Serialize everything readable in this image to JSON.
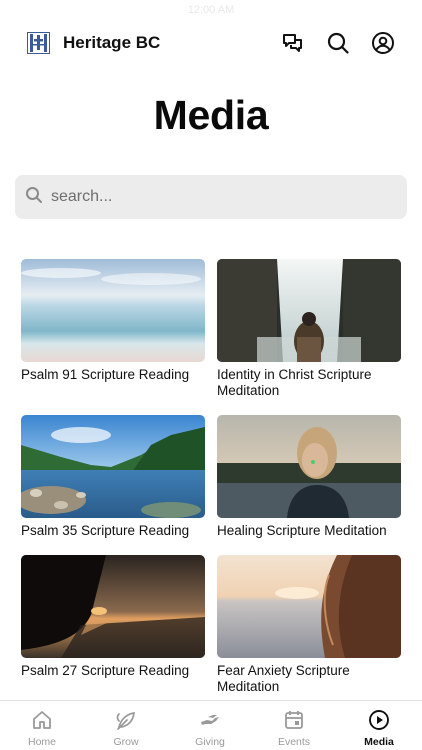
{
  "status_bar": {
    "time": "12:00 AM"
  },
  "header": {
    "brand": "Heritage BC"
  },
  "page": {
    "title": "Media"
  },
  "search": {
    "placeholder": "search..."
  },
  "media": [
    {
      "title": "Psalm 91 Scripture Reading"
    },
    {
      "title": "Identity in Christ Scripture Meditation"
    },
    {
      "title": "Psalm 35 Scripture Reading"
    },
    {
      "title": "Healing Scripture Meditation"
    },
    {
      "title": "Psalm 27 Scripture Reading"
    },
    {
      "title": "Fear Anxiety Scripture Meditation"
    }
  ],
  "tabs": [
    {
      "label": "Home",
      "icon": "home-icon"
    },
    {
      "label": "Grow",
      "icon": "leaf-icon"
    },
    {
      "label": "Giving",
      "icon": "giving-hand-icon"
    },
    {
      "label": "Events",
      "icon": "calendar-icon"
    },
    {
      "label": "Media",
      "icon": "play-circle-icon",
      "active": true
    }
  ],
  "colors": {
    "active_tab": "#111111",
    "inactive_tab": "#9a9a9a",
    "search_bg": "#ececec"
  }
}
